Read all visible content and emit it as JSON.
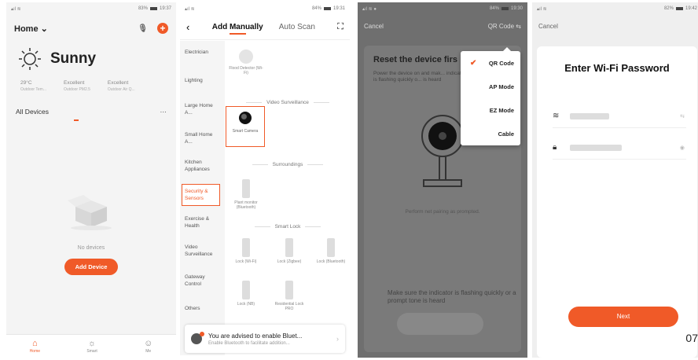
{
  "screen1": {
    "status_time": "19:37",
    "status_battery": "83%",
    "home_label": "Home",
    "weather_condition": "Sunny",
    "stats": [
      {
        "value": "29°C",
        "label": "Outdoor Tem..."
      },
      {
        "value": "Excellent",
        "label": "Outdoor PM2.5"
      },
      {
        "value": "Excellent",
        "label": "Outdoor Air Q..."
      }
    ],
    "all_devices": "All Devices",
    "more": "···",
    "no_devices": "No devices",
    "add_device": "Add Device",
    "tabs": [
      {
        "label": "Home"
      },
      {
        "label": "Smart"
      },
      {
        "label": "Me"
      }
    ]
  },
  "screen2": {
    "status_time": "19:31",
    "status_battery": "84%",
    "tab_manual": "Add Manually",
    "tab_auto": "Auto Scan",
    "categories": [
      "Electrician",
      "Lighting",
      "Large Home A...",
      "Small Home A...",
      "Kitchen Appliances",
      "Security & Sensors",
      "Exercise & Health",
      "Video Surveillance",
      "Gateway Control",
      "Others"
    ],
    "flood_detector": "Flood Detector (Wi-Fi)",
    "section_video": "Video Surveillance",
    "smart_camera": "Smart Camera",
    "section_surroundings": "Surroundings",
    "plant_monitor": "Plant monitor (Bluetooth)",
    "section_lock": "Smart Lock",
    "locks": [
      "Lock (Wi-Fi)",
      "Lock (Zigbee)",
      "Lock (Bluetooth)",
      "Lock (NB)",
      "Residential Lock PRO"
    ],
    "bt_title": "You are advised to enable Bluet...",
    "bt_sub": "Enable Bluetooth to facilitate addition..."
  },
  "screen3": {
    "status_time": "19:30",
    "status_battery": "84%",
    "cancel": "Cancel",
    "qr_code": "QR Code",
    "title": "Reset the device firs",
    "desc": "Power the device on and mak... indicator is flashing quickly o... is heard",
    "pairing": "Perform net pairing as prompted.",
    "check_text": "Make sure the indicator is flashing quickly or a prompt tone is heard",
    "menu": [
      "QR Code",
      "AP Mode",
      "EZ Mode",
      "Cable"
    ]
  },
  "screen4": {
    "status_time": "19:42",
    "status_battery": "82%",
    "cancel": "Cancel",
    "title": "Enter Wi-Fi Password",
    "next": "Next"
  },
  "page_number": "07"
}
